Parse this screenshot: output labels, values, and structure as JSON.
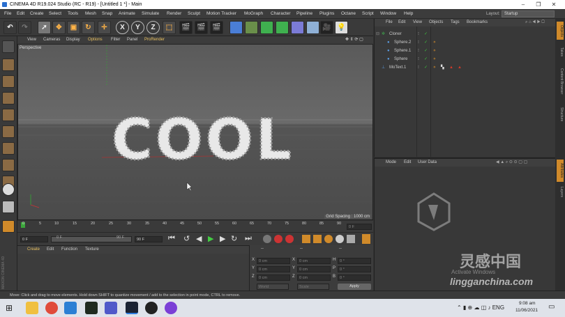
{
  "window": {
    "title": "CINEMA 4D R19.024 Studio (RC - R19) - [Untitled 1 *] - Main",
    "min": "–",
    "max": "❐",
    "close": "✕"
  },
  "menu": [
    "File",
    "Edit",
    "Create",
    "Select",
    "Tools",
    "Mesh",
    "Snap",
    "Animate",
    "Simulate",
    "Render",
    "Sculpt",
    "Motion Tracker",
    "MoGraph",
    "Character",
    "Pipeline",
    "Plugins",
    "Octane",
    "Script",
    "Window",
    "Help"
  ],
  "layout": {
    "label": "Layout:",
    "value": "Startup"
  },
  "toolbar": {
    "x": "X",
    "y": "Y",
    "z": "Z"
  },
  "viewport": {
    "menu": [
      "View",
      "Cameras",
      "Display",
      "Options",
      "Filter",
      "Panel",
      "ProRender"
    ],
    "label": "Perspective",
    "grid_spacing": "Grid Spacing : 1000 cm",
    "text": "COOL"
  },
  "timeline": {
    "ticks": [
      "0",
      "5",
      "10",
      "15",
      "20",
      "25",
      "30",
      "35",
      "40",
      "45",
      "50",
      "55",
      "60",
      "65",
      "70",
      "75",
      "80",
      "85",
      "90"
    ],
    "frame": "0 F"
  },
  "transport": {
    "start": "0 F",
    "current": "0 F",
    "end_field": "90 F",
    "end": "90 F"
  },
  "material": {
    "menu": [
      "Create",
      "Edit",
      "Function",
      "Texture"
    ]
  },
  "coords": {
    "header": [
      "--",
      "--",
      "--"
    ],
    "rows": [
      {
        "a": "X",
        "av": "0 cm",
        "b": "X",
        "bv": "0 cm",
        "c": "H",
        "cv": "0 °"
      },
      {
        "a": "Y",
        "av": "0 cm",
        "b": "Y",
        "bv": "0 cm",
        "c": "P",
        "cv": "0 °"
      },
      {
        "a": "Z",
        "av": "0 cm",
        "b": "Z",
        "bv": "0 cm",
        "c": "B",
        "cv": "0 °"
      }
    ],
    "world": "World",
    "scale": "Scale",
    "apply": "Apply"
  },
  "objects": {
    "menu": [
      "File",
      "Edit",
      "View",
      "Objects",
      "Tags",
      "Bookmarks"
    ],
    "items": [
      {
        "name": "Cloner",
        "indent": 0
      },
      {
        "name": "Sphere.2",
        "indent": 1
      },
      {
        "name": "Sphere.1",
        "indent": 1
      },
      {
        "name": "Sphere",
        "indent": 1
      },
      {
        "name": "MoText.1",
        "indent": 0
      }
    ]
  },
  "attributes": {
    "menu": [
      "Mode",
      "Edit",
      "User Data"
    ]
  },
  "righttabs": [
    "Objects",
    "Takes",
    "Content Browser",
    "Structure",
    "Attributes",
    "Layers"
  ],
  "status": "Move: Click and drag to move elements. Hold down SHIFT to quantize movement / add to the selection in point mode, CTRL to remove.",
  "watermark": {
    "activate": "Activate Windows",
    "cn": "灵感中国",
    "url": "lingganchina.com"
  },
  "taskbar": {
    "time": "9:08 am",
    "date": "11/06/2021"
  },
  "brand": {
    "maxon": "MAXON",
    "c4d": "CINEMA 4D"
  },
  "colors": {
    "accent": "#2e7de0",
    "key": "#3ba53b",
    "green_check": "#3cbf3c",
    "warning": "#d03a2a"
  }
}
